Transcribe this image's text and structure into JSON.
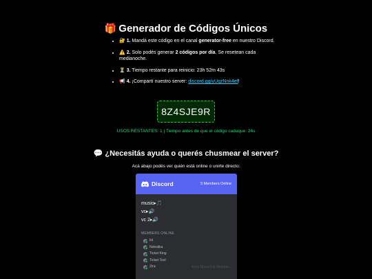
{
  "page": {
    "title_icon": "🎁",
    "title": "Generador de Códigos Únicos"
  },
  "steps": [
    {
      "icon": "🔐",
      "num": "1.",
      "pre": " Mandá este código en el canal ",
      "bold": "generator-free",
      "post": " en nuestro Discord."
    },
    {
      "icon": "⚠️",
      "num": "2.",
      "pre": " Solo podés generar ",
      "bold": "2 códigos por día",
      "post": ". Se resetean cada medianoche."
    },
    {
      "icon": "⏳",
      "num": "3.",
      "pre": " Tiempo restante para reinicio: ",
      "value": "23h 52m 43s"
    },
    {
      "icon": "📢",
      "num": "4.",
      "pre": " ¡Compartí nuestro server: ",
      "link": "discord.gg/yUqzNnk4ef",
      "post": "!"
    }
  ],
  "code": "8Z4SJE9R",
  "uses_line": "USOS RESTANTES: 1 | Tiempo antes de que el código caduque: 24s",
  "help": {
    "icon": "💬",
    "title": "¿Necesitás ayuda o querés chusmear el server?",
    "subtitle": "Acá abajo podés ver quién está online o unirte directo:"
  },
  "widget": {
    "brand": "Discord",
    "members_count": "5 Members Online",
    "channels": [
      "music▸🎵",
      "vc▸🔊",
      "vc 2▸🔊"
    ],
    "members_label": "MEMBERS ONLINE",
    "members": [
      "lol",
      "Nekotika",
      "Ticket King",
      "Ticket Tool",
      "Zira"
    ],
    "footer": "Hora Discord & Member..."
  }
}
